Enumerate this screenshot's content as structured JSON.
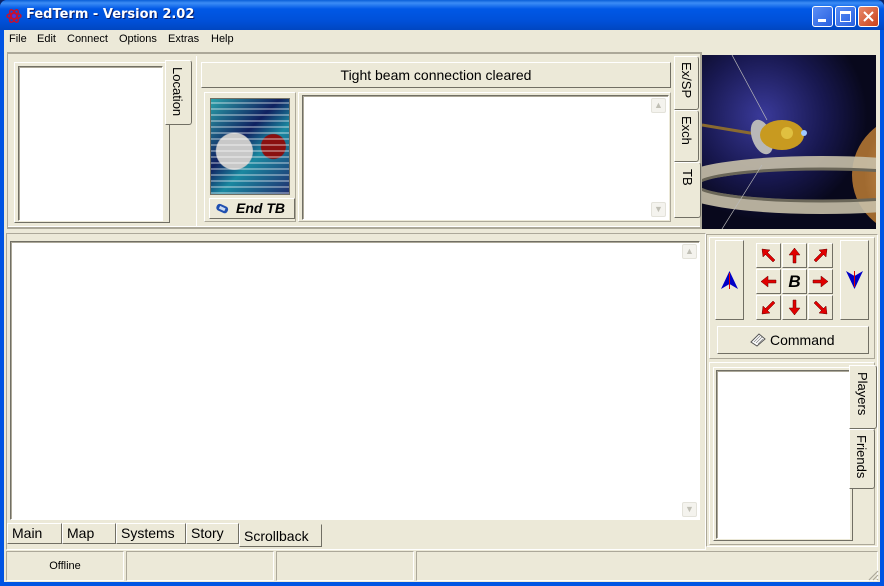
{
  "window": {
    "title": "FedTerm - Version 2.02",
    "app_icon": "atom-icon",
    "controls": {
      "minimize": "minimize-icon",
      "maximize": "maximize-icon",
      "close": "close-icon"
    }
  },
  "menubar": {
    "items": [
      "File",
      "Edit",
      "Connect",
      "Options",
      "Extras",
      "Help"
    ]
  },
  "location_panel": {
    "tab_label": "Location",
    "content": ""
  },
  "tightbeam": {
    "header": "Tight beam connection cleared",
    "avatar_icon": "static-noise-image",
    "end_button_label": "End TB",
    "end_button_icon": "phone-icon",
    "messages": "",
    "side_tabs": [
      {
        "label": "Ex/SP",
        "active": false
      },
      {
        "label": "Exch",
        "active": false
      },
      {
        "label": "TB",
        "active": true
      }
    ]
  },
  "scene_image": {
    "icon": "spacecraft-saturn-image"
  },
  "main_output": {
    "content": "",
    "tabs": [
      {
        "label": "Main",
        "active": false
      },
      {
        "label": "Map",
        "active": false
      },
      {
        "label": "Systems",
        "active": false
      },
      {
        "label": "Story",
        "active": false
      },
      {
        "label": "Scrollback",
        "active": true
      }
    ]
  },
  "navigation": {
    "up_button": "up-icon",
    "down_button": "down-icon",
    "directions": [
      "nw",
      "n",
      "ne",
      "w",
      "board",
      "e",
      "sw",
      "s",
      "se"
    ],
    "center_label": "B",
    "command_label": "Command",
    "command_icon": "keyboard-icon",
    "arrow_color": "#e00000",
    "updown_color": "#0000c8"
  },
  "players_panel": {
    "tabs": [
      {
        "label": "Players",
        "active": true
      },
      {
        "label": "Friends",
        "active": false
      }
    ],
    "content": ""
  },
  "statusbar": {
    "panels": [
      "Offline",
      "",
      "",
      ""
    ]
  }
}
